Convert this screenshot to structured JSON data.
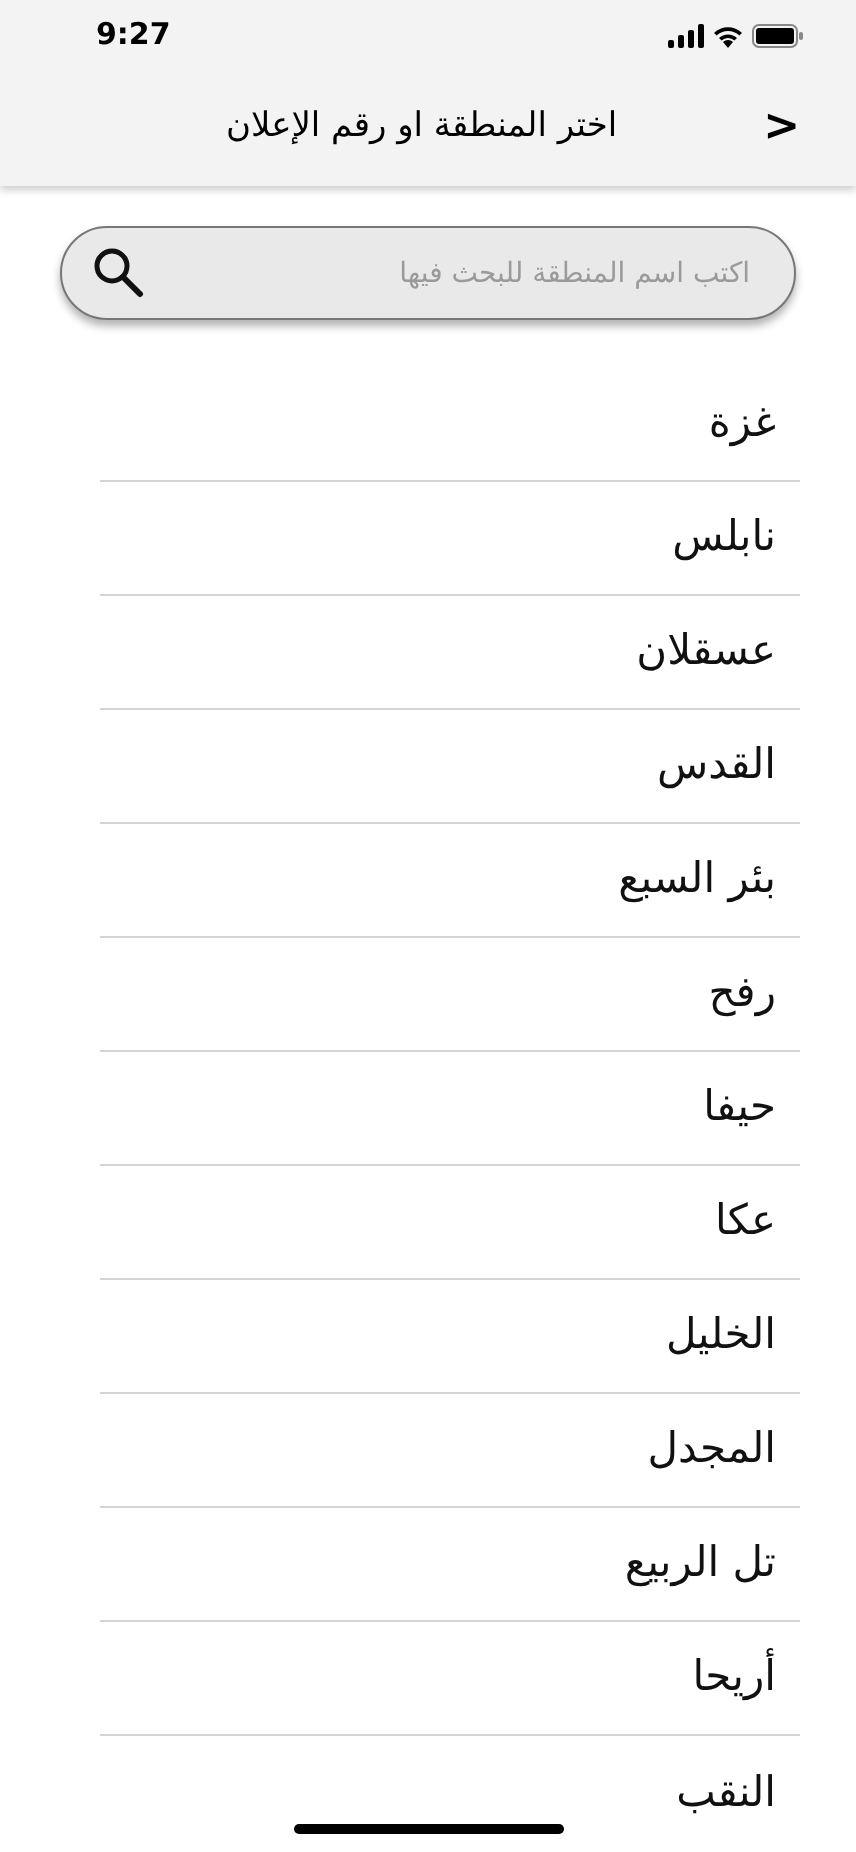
{
  "status_bar": {
    "time": "9:27"
  },
  "header": {
    "title": "اختر المنطقة او رقم الإعلان",
    "back": ">"
  },
  "search": {
    "placeholder": "اكتب اسم المنطقة للبحث فيها"
  },
  "regions": [
    {
      "name": "غزة"
    },
    {
      "name": "نابلس"
    },
    {
      "name": "عسقلان"
    },
    {
      "name": "القدس"
    },
    {
      "name": "بئر السبع"
    },
    {
      "name": "رفح"
    },
    {
      "name": "حيفا"
    },
    {
      "name": "عكا"
    },
    {
      "name": "الخليل"
    },
    {
      "name": "المجدل"
    },
    {
      "name": "تل الربيع"
    },
    {
      "name": "أريحا"
    },
    {
      "name": "النقب"
    }
  ]
}
